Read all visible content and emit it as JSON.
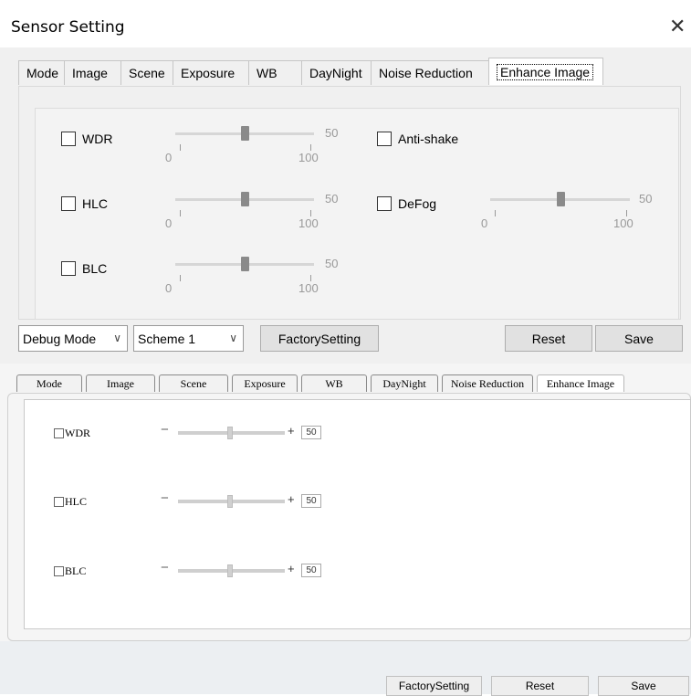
{
  "dialog": {
    "title": "Sensor Setting",
    "close_glyph": "✕",
    "tabs": [
      "Mode",
      "Image",
      "Scene",
      "Exposure",
      "WB",
      "DayNight",
      "Noise Reduction",
      "Enhance Image"
    ],
    "active_tab": "Enhance Image",
    "options": [
      {
        "label": "WDR",
        "checked": false,
        "value": "50",
        "min": "0",
        "max": "100"
      },
      {
        "label": "HLC",
        "checked": false,
        "value": "50",
        "min": "0",
        "max": "100"
      },
      {
        "label": "BLC",
        "checked": false,
        "value": "50",
        "min": "0",
        "max": "100"
      },
      {
        "label": "Anti-shake",
        "checked": false
      },
      {
        "label": "DeFog",
        "checked": false,
        "value": "50",
        "min": "0",
        "max": "100"
      }
    ],
    "bottom": {
      "debug_mode": "Debug Mode",
      "scheme": "Scheme 1",
      "factory_label": "FactorySetting",
      "reset_label": "Reset",
      "save_label": "Save"
    },
    "chevron_glyph": "∨"
  },
  "web": {
    "tabs": [
      "Mode",
      "Image",
      "Scene",
      "Exposure",
      "WB",
      "DayNight",
      "Noise Reduction",
      "Enhance Image"
    ],
    "active_tab": "Enhance Image",
    "options": [
      {
        "label": "WDR",
        "checked": false,
        "value": "50"
      },
      {
        "label": "HLC",
        "checked": false,
        "value": "50"
      },
      {
        "label": "BLC",
        "checked": false,
        "value": "50"
      }
    ],
    "minus_glyph": "−",
    "plus_glyph": "+",
    "footer": {
      "factory_label": "FactorySetting",
      "reset_label": "Reset",
      "save_label": "Save"
    }
  }
}
